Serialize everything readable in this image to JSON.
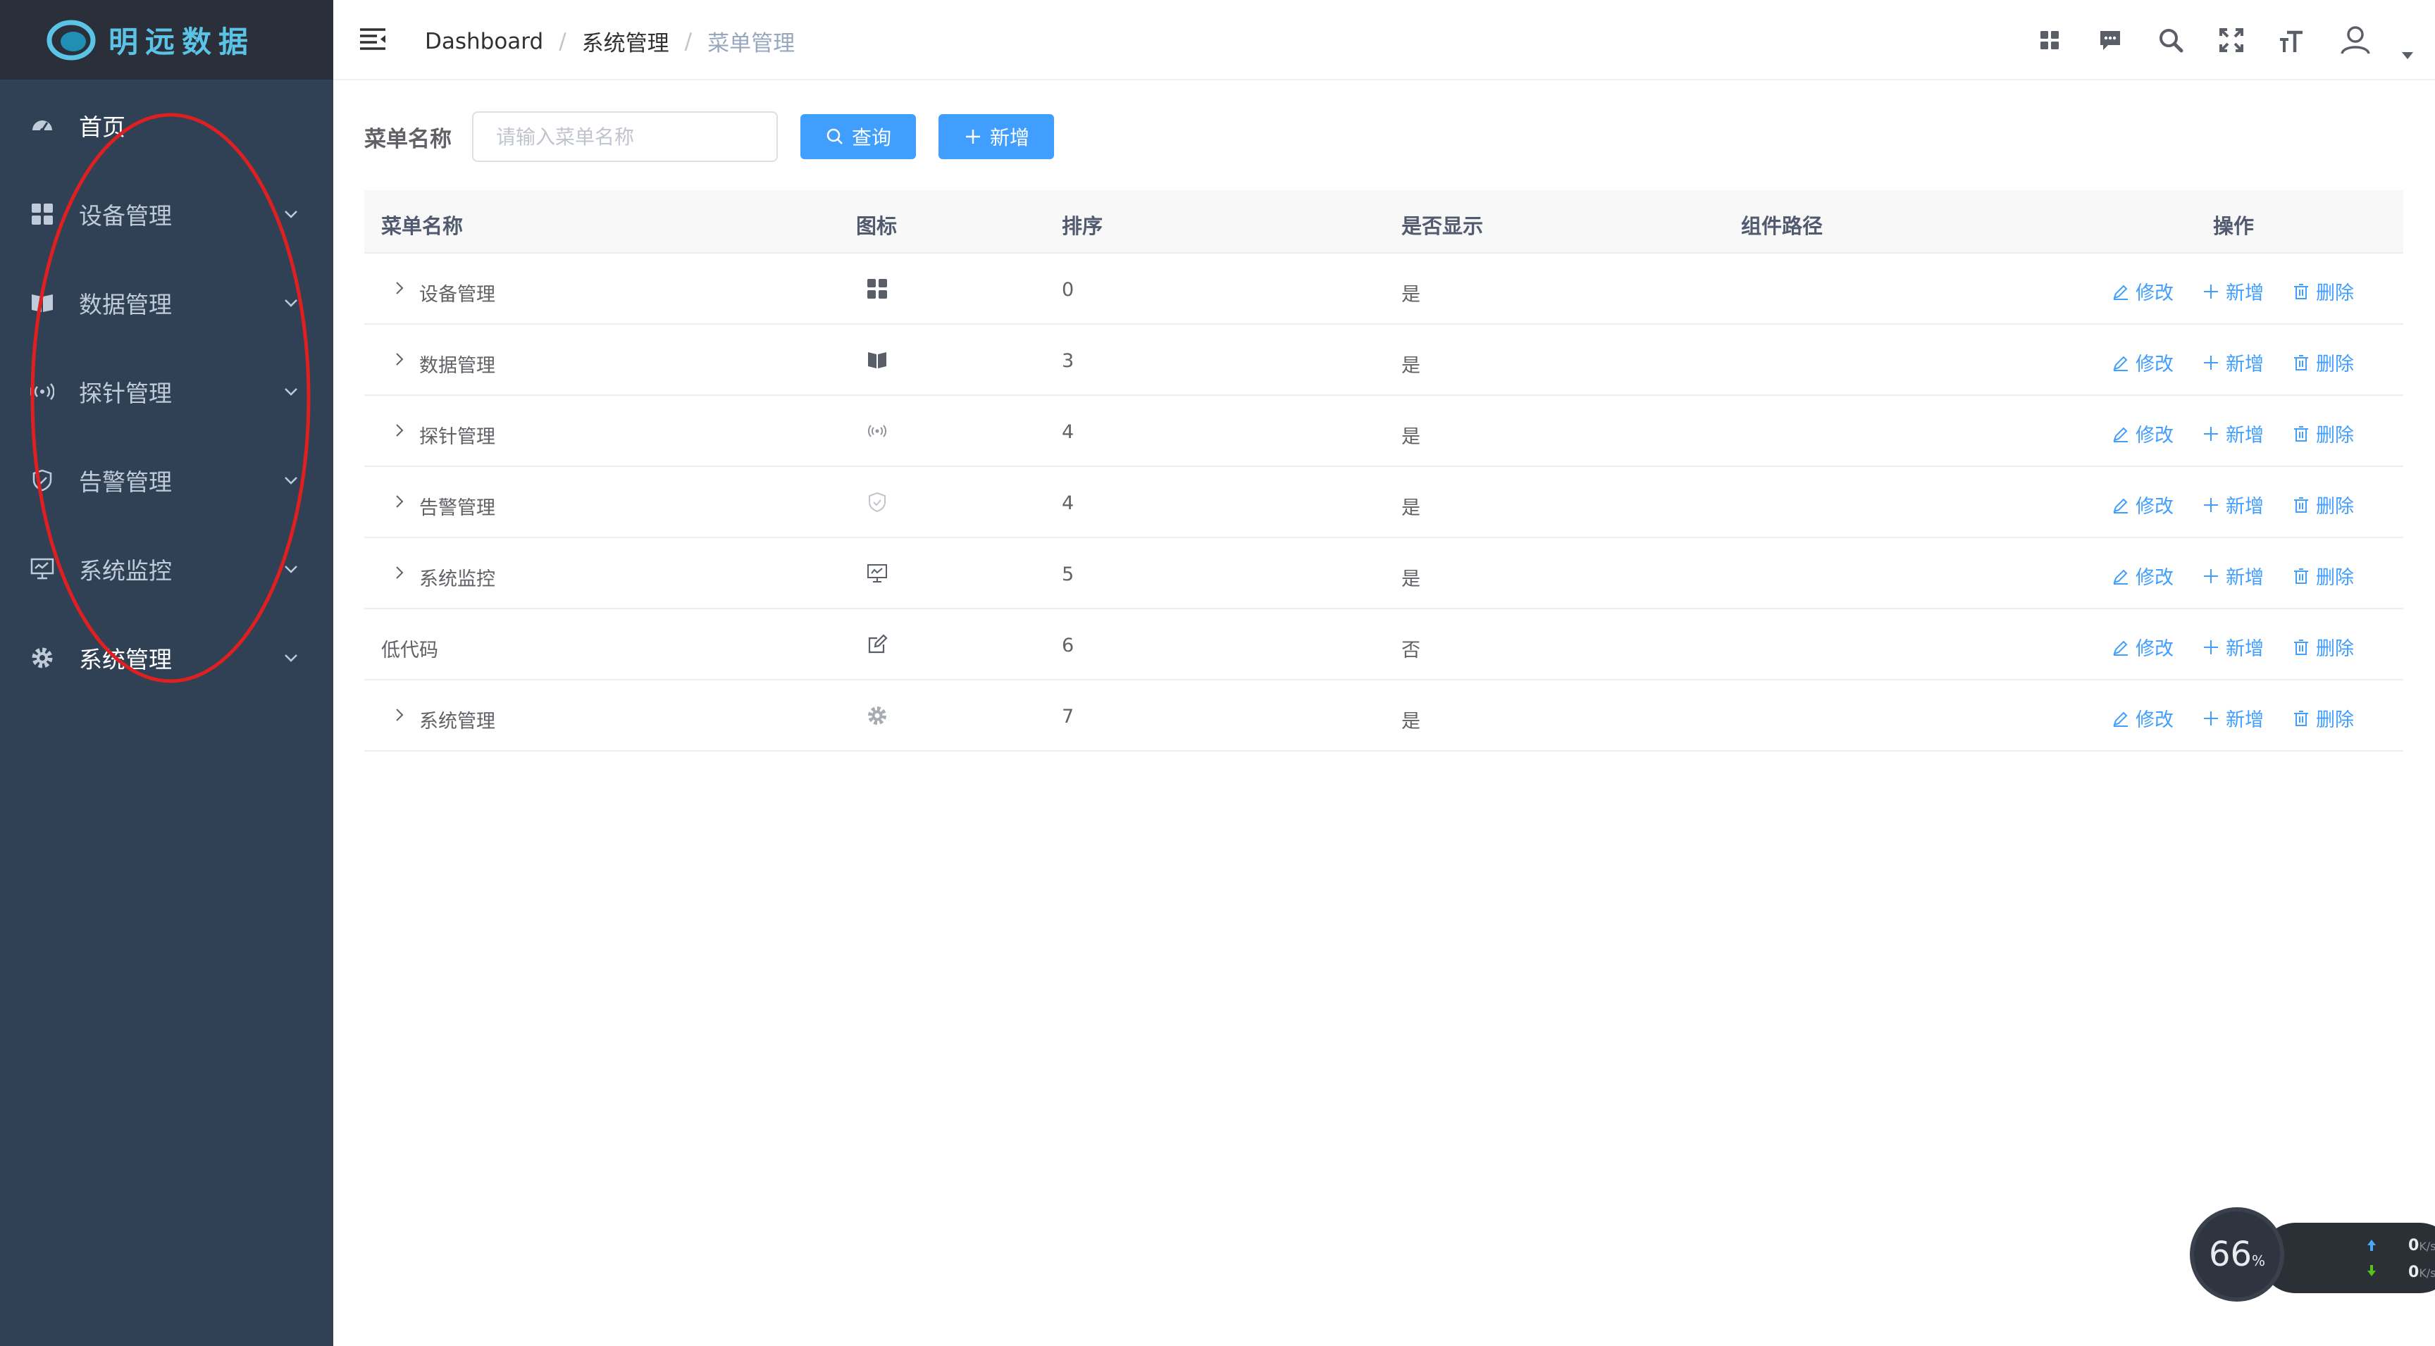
{
  "brand": {
    "name": "明远数据"
  },
  "sidebar": {
    "items": [
      {
        "label": "首页",
        "icon": "dashboard-icon",
        "has_children": false
      },
      {
        "label": "设备管理",
        "icon": "grid-icon",
        "has_children": true
      },
      {
        "label": "数据管理",
        "icon": "book-icon",
        "has_children": true
      },
      {
        "label": "探针管理",
        "icon": "signal-icon",
        "has_children": true
      },
      {
        "label": "告警管理",
        "icon": "shield-icon",
        "has_children": true
      },
      {
        "label": "系统监控",
        "icon": "monitor-icon",
        "has_children": true
      },
      {
        "label": "系统管理",
        "icon": "gear-icon",
        "has_children": true
      }
    ],
    "annotation_color": "#e02020"
  },
  "header": {
    "breadcrumb": [
      "Dashboard",
      "系统管理",
      "菜单管理"
    ],
    "icons": [
      "grid-icon",
      "chat-icon",
      "search-icon",
      "fullscreen-icon",
      "font-size-icon",
      "user-icon"
    ]
  },
  "search": {
    "label": "菜单名称",
    "placeholder": "请输入菜单名称",
    "query_button": "查询",
    "add_button": "新增"
  },
  "table": {
    "columns": [
      "菜单名称",
      "图标",
      "排序",
      "是否显示",
      "组件路径",
      "操作"
    ],
    "rows": [
      {
        "name": "设备管理",
        "icon": "grid-icon",
        "order": "0",
        "visible": "是",
        "path": "",
        "expandable": true
      },
      {
        "name": "数据管理",
        "icon": "book-icon",
        "order": "3",
        "visible": "是",
        "path": "",
        "expandable": true
      },
      {
        "name": "探针管理",
        "icon": "signal-icon",
        "order": "4",
        "visible": "是",
        "path": "",
        "expandable": true
      },
      {
        "name": "告警管理",
        "icon": "shield-icon",
        "order": "4",
        "visible": "是",
        "path": "",
        "expandable": true
      },
      {
        "name": "系统监控",
        "icon": "monitor-icon",
        "order": "5",
        "visible": "是",
        "path": "",
        "expandable": true
      },
      {
        "name": "低代码",
        "icon": "edit-icon",
        "order": "6",
        "visible": "否",
        "path": "",
        "expandable": false
      },
      {
        "name": "系统管理",
        "icon": "gear-icon",
        "order": "7",
        "visible": "是",
        "path": "",
        "expandable": true
      }
    ],
    "actions": {
      "edit": "修改",
      "add": "新增",
      "delete": "删除"
    }
  },
  "net_widget": {
    "percent": "66",
    "percent_unit": "%",
    "up": "0",
    "down": "0",
    "unit": "K/s"
  },
  "colors": {
    "sidebar_bg": "#304156",
    "primary": "#409eff",
    "header_bg": "#ffffff"
  }
}
